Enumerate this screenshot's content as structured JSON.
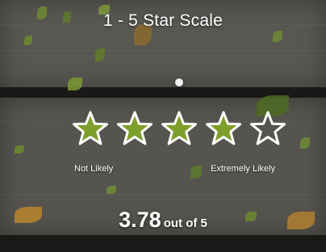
{
  "title": "1 - 5 Star Scale",
  "rating": {
    "value": 3.78,
    "max": 5,
    "filled_count": 4,
    "fill_color": "#7e9f2b",
    "outline_color": "#ffffff"
  },
  "labels": {
    "low": "Not Likely",
    "high": "Extremely Likely"
  },
  "score": {
    "value_text": "3.78",
    "suffix": "out of 5"
  },
  "colors": {
    "background": "#55534e",
    "text": "#ffffff"
  }
}
